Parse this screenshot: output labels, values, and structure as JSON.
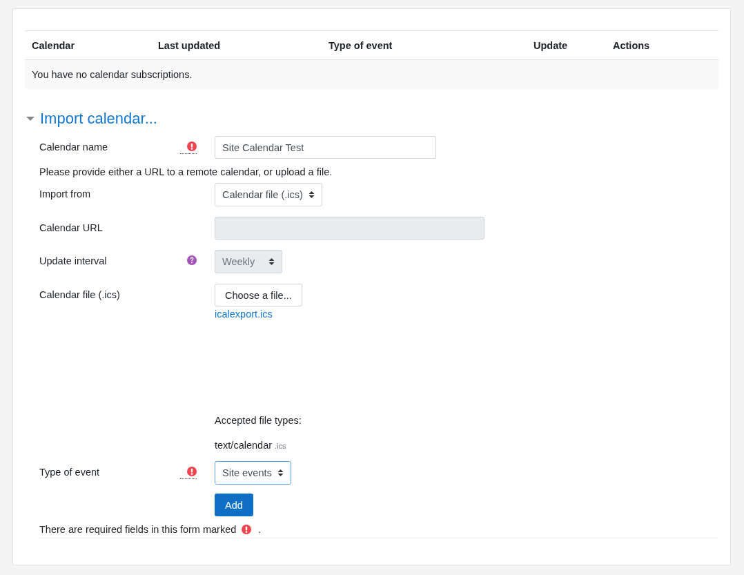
{
  "table": {
    "columns": [
      "Calendar",
      "Last updated",
      "Type of event",
      "Update",
      "Actions"
    ],
    "empty_message": "You have no calendar subscriptions."
  },
  "section": {
    "title": "Import calendar...",
    "expanded": true
  },
  "form": {
    "fields": [
      {
        "kind": "text",
        "label": "Calendar name",
        "required": true,
        "value": "Site Calendar Test",
        "disabled": false
      },
      {
        "kind": "static",
        "text": "Please provide either a URL to a remote calendar, or upload a file."
      },
      {
        "kind": "select",
        "label": "Import from",
        "value": "Calendar file (.ics)",
        "disabled": false,
        "focused": false
      },
      {
        "kind": "text",
        "label": "Calendar URL",
        "required": false,
        "disabled": true
      },
      {
        "kind": "select",
        "label": "Update interval",
        "help": true,
        "value": "Weekly",
        "disabled": true,
        "focused": false
      },
      {
        "kind": "file",
        "label": "Calendar file (.ics)",
        "button": "Choose a file...",
        "filename": "icalexport.ics",
        "accepted_label": "Accepted file types:",
        "accepted_type": "text/calendar",
        "extension": ".ics"
      },
      {
        "kind": "select",
        "label": "Type of event",
        "required": true,
        "value": "Site events",
        "disabled": false,
        "focused": true
      }
    ],
    "submit": "Add",
    "note_before": "There are required fields in this form marked",
    "note_after": "."
  }
}
